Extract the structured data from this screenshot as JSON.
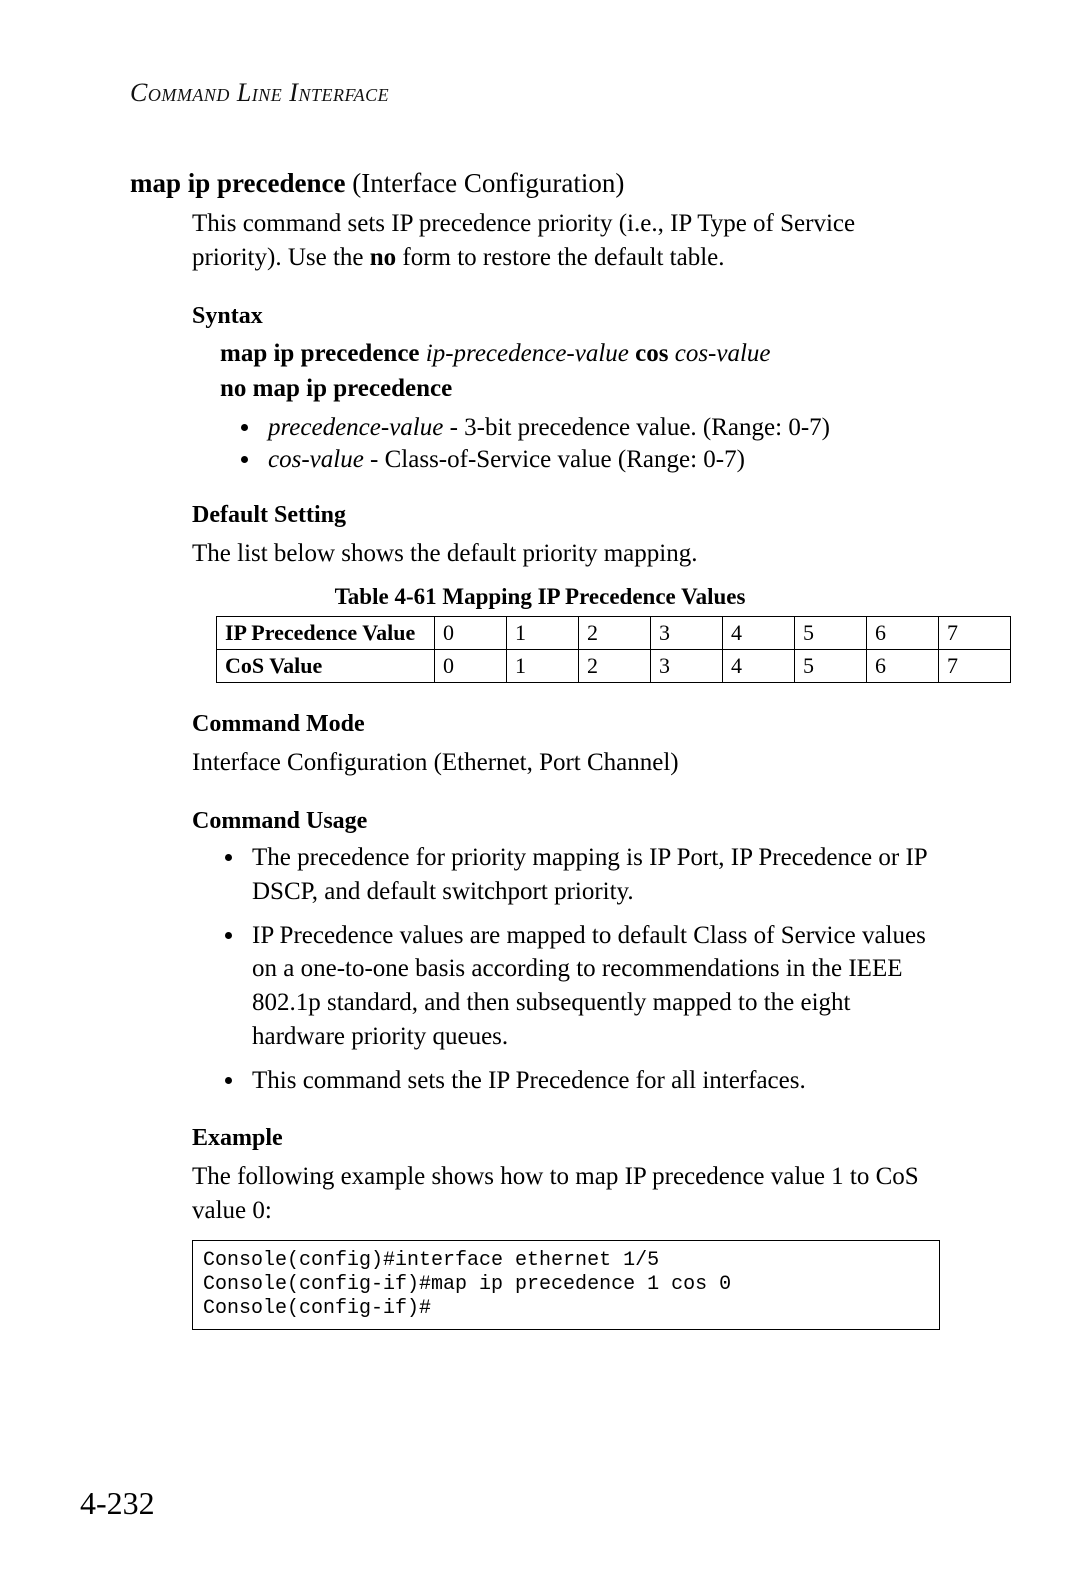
{
  "running_header": "Command Line Interface",
  "title": {
    "command": "map ip precedence",
    "context": " (Interface Configuration)"
  },
  "intro": "This command sets IP precedence priority (i.e., IP Type of Service priority). Use the ",
  "intro_bold": "no",
  "intro2": " form to restore the default table.",
  "syntax": {
    "label": "Syntax",
    "line1_bold1": "map ip precedence",
    "line1_ital1": " ip-precedence-value ",
    "line1_bold2": "cos",
    "line1_ital2": " cos-value",
    "line2_bold": "no map ip precedence",
    "params": [
      {
        "ital": "precedence-value",
        "rest": " - 3-bit precedence value. (Range: 0-7)"
      },
      {
        "ital": "cos-value",
        "rest": " - Class-of-Service value (Range: 0-7)"
      }
    ]
  },
  "default_setting": {
    "label": "Default Setting",
    "text": "The list below shows the default priority mapping."
  },
  "table": {
    "caption": "Table 4-61  Mapping IP Precedence Values",
    "row1_label": "IP Precedence Value",
    "row2_label": "CoS Value",
    "cols": [
      "0",
      "1",
      "2",
      "3",
      "4",
      "5",
      "6",
      "7"
    ],
    "cos": [
      "0",
      "1",
      "2",
      "3",
      "4",
      "5",
      "6",
      "7"
    ]
  },
  "command_mode": {
    "label": "Command Mode",
    "text": "Interface Configuration (Ethernet, Port Channel)"
  },
  "command_usage": {
    "label": "Command Usage",
    "items": [
      "The precedence for priority mapping is IP Port, IP Precedence or IP DSCP, and default switchport priority.",
      "IP Precedence values are mapped to default Class of Service values on a one-to-one basis according to recommendations in the IEEE 802.1p standard, and then subsequently mapped to the eight hardware priority queues.",
      "This command sets the IP Precedence for all interfaces."
    ]
  },
  "example": {
    "label": "Example",
    "text": "The following example shows how to map IP precedence value 1 to CoS value 0:",
    "code": "Console(config)#interface ethernet 1/5\nConsole(config-if)#map ip precedence 1 cos 0\nConsole(config-if)#"
  },
  "page_number": "4-232",
  "chart_data": {
    "type": "table",
    "title": "Table 4-61  Mapping IP Precedence Values",
    "columns": [
      "IP Precedence Value",
      "0",
      "1",
      "2",
      "3",
      "4",
      "5",
      "6",
      "7"
    ],
    "rows": [
      [
        "CoS Value",
        "0",
        "1",
        "2",
        "3",
        "4",
        "5",
        "6",
        "7"
      ]
    ]
  }
}
